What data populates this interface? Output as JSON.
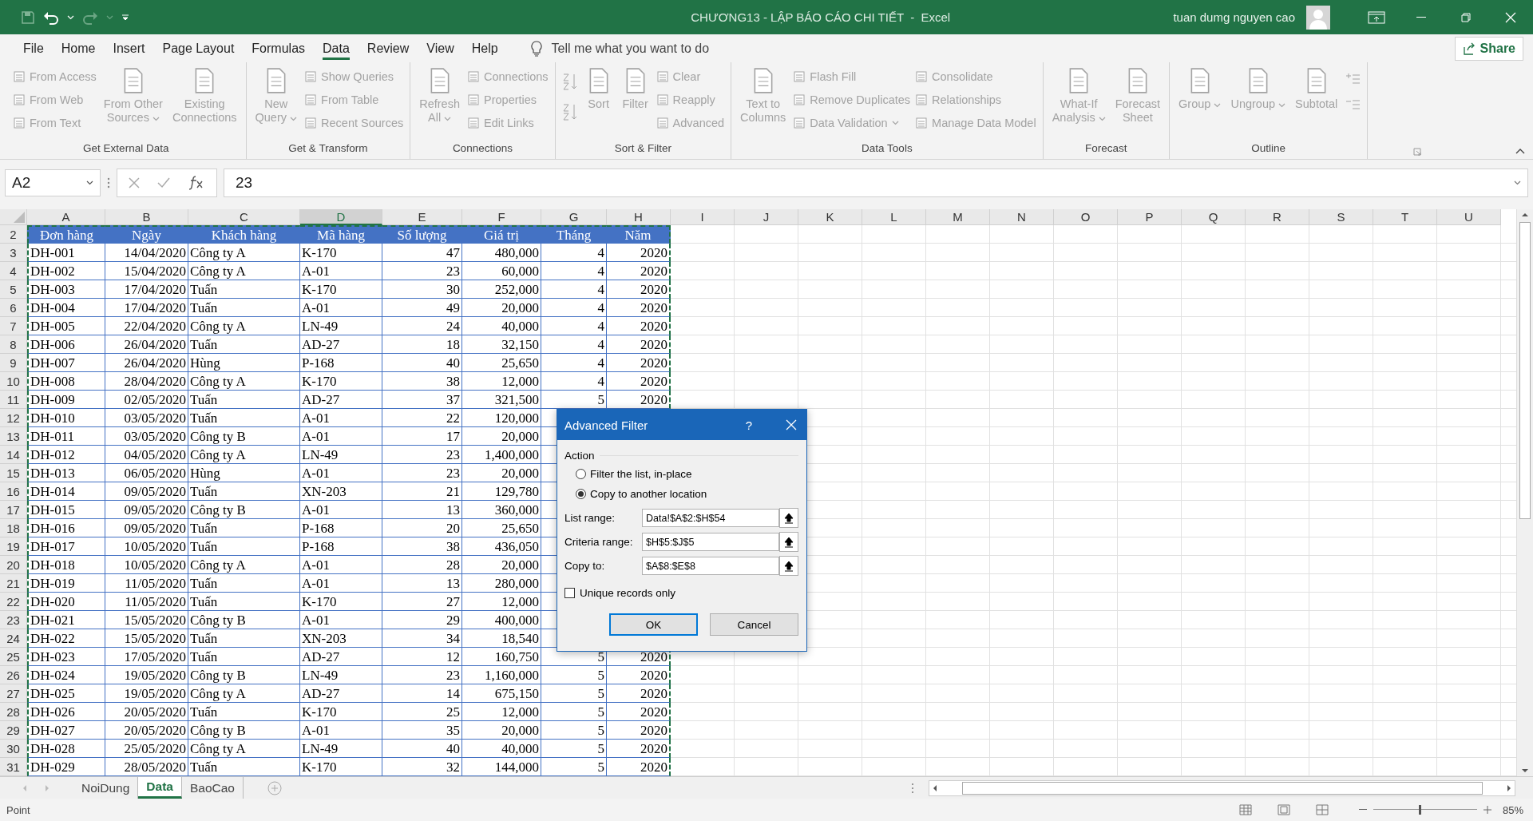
{
  "title_bar": {
    "title": "CHƯƠNG13 - LẬP BÁO CÁO CHI TIẾT  -  Excel",
    "user": "tuan dumg nguyen cao"
  },
  "menu_tabs": [
    {
      "label": "File",
      "selected": false
    },
    {
      "label": "Home",
      "selected": false
    },
    {
      "label": "Insert",
      "selected": false
    },
    {
      "label": "Page Layout",
      "selected": false
    },
    {
      "label": "Formulas",
      "selected": false
    },
    {
      "label": "Data",
      "selected": true
    },
    {
      "label": "Review",
      "selected": false
    },
    {
      "label": "View",
      "selected": false
    },
    {
      "label": "Help",
      "selected": false
    }
  ],
  "tell_me": {
    "placeholder": "Tell me what you want to do"
  },
  "share_button": "Share",
  "ribbon": {
    "disabled": true,
    "groups": [
      {
        "label": "Get External Data",
        "columns": [
          {
            "kind": "stack",
            "items": [
              {
                "label": "From Access",
                "dropdown": false
              },
              {
                "label": "From Web",
                "dropdown": false
              },
              {
                "label": "From Text",
                "dropdown": false
              }
            ]
          },
          {
            "kind": "large",
            "lines": [
              "From Other",
              "Sources"
            ],
            "dropdown": true
          },
          {
            "kind": "large",
            "lines": [
              "Existing",
              "Connections"
            ],
            "dropdown": false
          }
        ]
      },
      {
        "label": "Get & Transform",
        "columns": [
          {
            "kind": "large",
            "lines": [
              "New",
              "Query"
            ],
            "dropdown": true
          },
          {
            "kind": "stack",
            "items": [
              {
                "label": "Show Queries",
                "dropdown": false
              },
              {
                "label": "From Table",
                "dropdown": false
              },
              {
                "label": "Recent Sources",
                "dropdown": false
              }
            ]
          }
        ]
      },
      {
        "label": "Connections",
        "columns": [
          {
            "kind": "large",
            "lines": [
              "Refresh",
              "All"
            ],
            "dropdown": true
          },
          {
            "kind": "stack",
            "items": [
              {
                "label": "Connections",
                "dropdown": false
              },
              {
                "label": "Properties",
                "dropdown": false
              },
              {
                "label": "Edit Links",
                "dropdown": false
              }
            ]
          }
        ]
      },
      {
        "label": "Sort & Filter",
        "columns": [
          {
            "kind": "sort-icons"
          },
          {
            "kind": "large",
            "lines": [
              "Sort"
            ],
            "dropdown": false
          },
          {
            "kind": "large",
            "lines": [
              "Filter"
            ],
            "dropdown": false
          },
          {
            "kind": "stack",
            "items": [
              {
                "label": "Clear",
                "dropdown": false
              },
              {
                "label": "Reapply",
                "dropdown": false
              },
              {
                "label": "Advanced",
                "dropdown": false
              }
            ]
          }
        ]
      },
      {
        "label": "Data Tools",
        "columns": [
          {
            "kind": "large",
            "lines": [
              "Text to",
              "Columns"
            ],
            "dropdown": false
          },
          {
            "kind": "stack",
            "items": [
              {
                "label": "Flash Fill",
                "dropdown": false
              },
              {
                "label": "Remove Duplicates",
                "dropdown": false
              },
              {
                "label": "Data Validation",
                "dropdown": true
              }
            ]
          },
          {
            "kind": "stack",
            "items": [
              {
                "label": "Consolidate",
                "dropdown": false
              },
              {
                "label": "Relationships",
                "dropdown": false
              },
              {
                "label": "Manage Data Model",
                "dropdown": false
              }
            ]
          }
        ]
      },
      {
        "label": "Forecast",
        "columns": [
          {
            "kind": "large",
            "lines": [
              "What-If",
              "Analysis"
            ],
            "dropdown": true
          },
          {
            "kind": "large",
            "lines": [
              "Forecast",
              "Sheet"
            ],
            "dropdown": false
          }
        ]
      },
      {
        "label": "Outline",
        "columns": [
          {
            "kind": "large",
            "lines": [
              "Group"
            ],
            "dropdown": true
          },
          {
            "kind": "large",
            "lines": [
              "Ungroup"
            ],
            "dropdown": true
          },
          {
            "kind": "large",
            "lines": [
              "Subtotal"
            ],
            "dropdown": false
          },
          {
            "kind": "detail-icons"
          }
        ]
      }
    ]
  },
  "formula_bar": {
    "name_box": "A2",
    "value": "23"
  },
  "sheet": {
    "columns": [
      {
        "label": "A",
        "selected": false
      },
      {
        "label": "B",
        "selected": false
      },
      {
        "label": "C",
        "selected": false
      },
      {
        "label": "D",
        "selected": true
      },
      {
        "label": "E",
        "selected": false
      },
      {
        "label": "F",
        "selected": false
      },
      {
        "label": "G",
        "selected": false
      },
      {
        "label": "H",
        "selected": false
      },
      {
        "label": "I",
        "selected": false
      },
      {
        "label": "J",
        "selected": false
      },
      {
        "label": "K",
        "selected": false
      },
      {
        "label": "L",
        "selected": false
      },
      {
        "label": "M",
        "selected": false
      },
      {
        "label": "N",
        "selected": false
      },
      {
        "label": "O",
        "selected": false
      },
      {
        "label": "P",
        "selected": false
      },
      {
        "label": "Q",
        "selected": false
      },
      {
        "label": "R",
        "selected": false
      },
      {
        "label": "S",
        "selected": false
      },
      {
        "label": "T",
        "selected": false
      },
      {
        "label": "U",
        "selected": false
      }
    ],
    "rows": [
      {
        "number": "2",
        "kind": "header",
        "cells": [
          "Đơn hàng",
          "Ngày",
          "Khách hàng",
          "Mã hàng",
          "Số lượng",
          "Giá trị",
          "Tháng",
          "Năm"
        ]
      },
      {
        "number": "3",
        "kind": "data",
        "cells": [
          "DH-001",
          "14/04/2020",
          "Công ty A",
          "K-170",
          "47",
          "480,000",
          "4",
          "2020"
        ]
      },
      {
        "number": "4",
        "kind": "data",
        "cells": [
          "DH-002",
          "15/04/2020",
          "Công ty A",
          "A-01",
          "23",
          "60,000",
          "4",
          "2020"
        ]
      },
      {
        "number": "5",
        "kind": "data",
        "cells": [
          "DH-003",
          "17/04/2020",
          "Tuấn",
          "K-170",
          "30",
          "252,000",
          "4",
          "2020"
        ]
      },
      {
        "number": "6",
        "kind": "data",
        "cells": [
          "DH-004",
          "17/04/2020",
          "Tuấn",
          "A-01",
          "49",
          "20,000",
          "4",
          "2020"
        ]
      },
      {
        "number": "7",
        "kind": "data",
        "cells": [
          "DH-005",
          "22/04/2020",
          "Công ty A",
          "LN-49",
          "24",
          "40,000",
          "4",
          "2020"
        ]
      },
      {
        "number": "8",
        "kind": "data",
        "cells": [
          "DH-006",
          "26/04/2020",
          "Tuấn",
          "AD-27",
          "18",
          "32,150",
          "4",
          "2020"
        ]
      },
      {
        "number": "9",
        "kind": "data",
        "cells": [
          "DH-007",
          "26/04/2020",
          "Hùng",
          "P-168",
          "40",
          "25,650",
          "4",
          "2020"
        ]
      },
      {
        "number": "10",
        "kind": "data",
        "cells": [
          "DH-008",
          "28/04/2020",
          "Công ty A",
          "K-170",
          "38",
          "12,000",
          "4",
          "2020"
        ]
      },
      {
        "number": "11",
        "kind": "data",
        "cells": [
          "DH-009",
          "02/05/2020",
          "Tuấn",
          "AD-27",
          "37",
          "321,500",
          "5",
          "2020"
        ]
      },
      {
        "number": "12",
        "kind": "data",
        "cells": [
          "DH-010",
          "03/05/2020",
          "Tuấn",
          "A-01",
          "22",
          "120,000"
        ]
      },
      {
        "number": "13",
        "kind": "data",
        "cells": [
          "DH-011",
          "03/05/2020",
          "Công ty B",
          "A-01",
          "17",
          "20,000"
        ]
      },
      {
        "number": "14",
        "kind": "data",
        "cells": [
          "DH-012",
          "04/05/2020",
          "Công ty A",
          "LN-49",
          "23",
          "1,400,000"
        ]
      },
      {
        "number": "15",
        "kind": "data",
        "cells": [
          "DH-013",
          "06/05/2020",
          "Hùng",
          "A-01",
          "23",
          "20,000"
        ]
      },
      {
        "number": "16",
        "kind": "data",
        "cells": [
          "DH-014",
          "09/05/2020",
          "Tuấn",
          "XN-203",
          "21",
          "129,780"
        ]
      },
      {
        "number": "17",
        "kind": "data",
        "cells": [
          "DH-015",
          "09/05/2020",
          "Công ty B",
          "A-01",
          "13",
          "360,000"
        ]
      },
      {
        "number": "18",
        "kind": "data",
        "cells": [
          "DH-016",
          "09/05/2020",
          "Tuấn",
          "P-168",
          "20",
          "25,650"
        ]
      },
      {
        "number": "19",
        "kind": "data",
        "cells": [
          "DH-017",
          "10/05/2020",
          "Tuấn",
          "P-168",
          "38",
          "436,050"
        ]
      },
      {
        "number": "20",
        "kind": "data",
        "cells": [
          "DH-018",
          "10/05/2020",
          "Công ty A",
          "A-01",
          "28",
          "20,000"
        ]
      },
      {
        "number": "21",
        "kind": "data",
        "cells": [
          "DH-019",
          "11/05/2020",
          "Tuấn",
          "A-01",
          "13",
          "280,000"
        ]
      },
      {
        "number": "22",
        "kind": "data",
        "cells": [
          "DH-020",
          "11/05/2020",
          "Tuấn",
          "K-170",
          "27",
          "12,000"
        ]
      },
      {
        "number": "23",
        "kind": "data",
        "cells": [
          "DH-021",
          "15/05/2020",
          "Công ty B",
          "A-01",
          "29",
          "400,000"
        ]
      },
      {
        "number": "24",
        "kind": "data",
        "cells": [
          "DH-022",
          "15/05/2020",
          "Tuấn",
          "XN-203",
          "34",
          "18,540"
        ]
      },
      {
        "number": "25",
        "kind": "data",
        "cells": [
          "DH-023",
          "17/05/2020",
          "Tuấn",
          "AD-27",
          "12",
          "160,750",
          "5",
          "2020"
        ]
      },
      {
        "number": "26",
        "kind": "data",
        "cells": [
          "DH-024",
          "19/05/2020",
          "Công ty B",
          "LN-49",
          "23",
          "1,160,000",
          "5",
          "2020"
        ]
      },
      {
        "number": "27",
        "kind": "data",
        "cells": [
          "DH-025",
          "19/05/2020",
          "Công ty A",
          "AD-27",
          "14",
          "675,150",
          "5",
          "2020"
        ]
      },
      {
        "number": "28",
        "kind": "data",
        "cells": [
          "DH-026",
          "20/05/2020",
          "Tuấn",
          "K-170",
          "25",
          "12,000",
          "5",
          "2020"
        ]
      },
      {
        "number": "29",
        "kind": "data",
        "cells": [
          "DH-027",
          "20/05/2020",
          "Công ty B",
          "A-01",
          "35",
          "20,000",
          "5",
          "2020"
        ]
      },
      {
        "number": "30",
        "kind": "data",
        "cells": [
          "DH-028",
          "25/05/2020",
          "Công ty A",
          "LN-49",
          "40",
          "40,000",
          "5",
          "2020"
        ]
      },
      {
        "number": "31",
        "kind": "data",
        "cells": [
          "DH-029",
          "28/05/2020",
          "Tuấn",
          "K-170",
          "32",
          "144,000",
          "5",
          "2020"
        ]
      }
    ]
  },
  "dialog": {
    "title": "Advanced Filter",
    "help": "?",
    "section": "Action",
    "action_options": [
      {
        "label": "Filter the list, in-place",
        "selected": false
      },
      {
        "label": "Copy to another location",
        "selected": true
      }
    ],
    "fields": [
      {
        "label": "List range:",
        "value": "Data!$A$2:$H$54"
      },
      {
        "label": "Criteria range:",
        "value": "$H$5:$J$5"
      },
      {
        "label": "Copy to:",
        "value": "$A$8:$E$8"
      }
    ],
    "unique_records": {
      "label": "Unique records only",
      "checked": false
    },
    "buttons": [
      {
        "label": "OK",
        "default": true
      },
      {
        "label": "Cancel",
        "default": false
      }
    ]
  },
  "sheet_tabs": [
    {
      "label": "NoiDung",
      "selected": false
    },
    {
      "label": "Data",
      "selected": true
    },
    {
      "label": "BaoCao",
      "selected": false
    }
  ],
  "status_bar": {
    "mode": "Point",
    "zoom": {
      "level": 0.45,
      "reading": "85%"
    }
  }
}
